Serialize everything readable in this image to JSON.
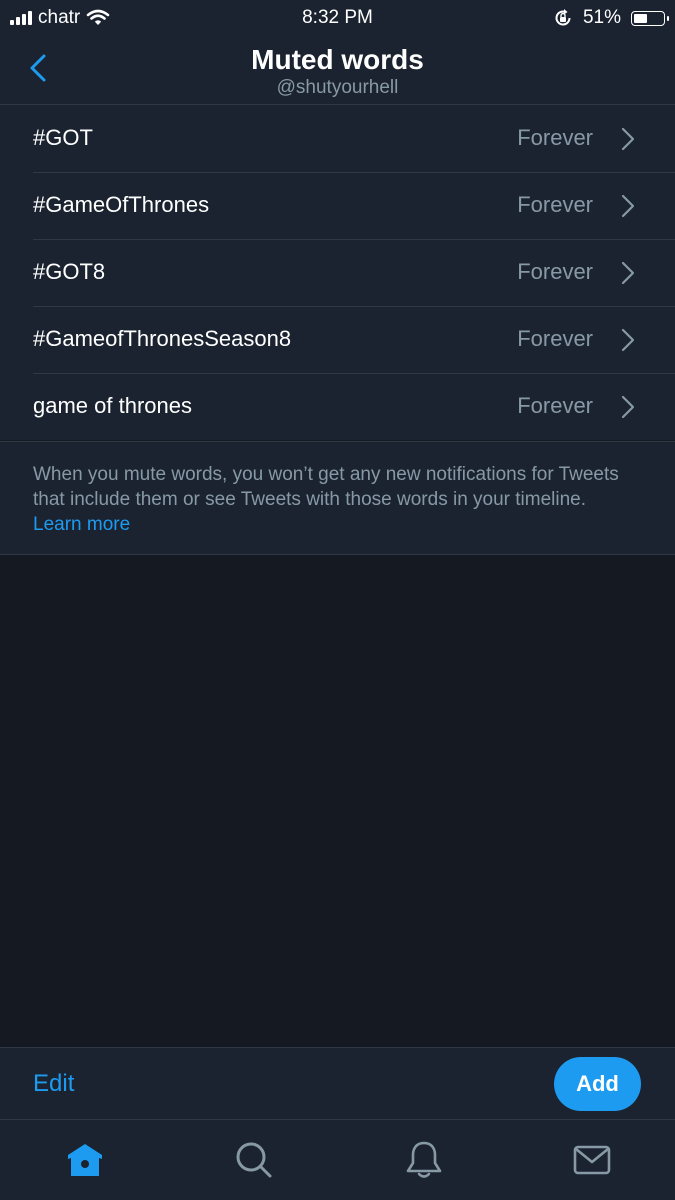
{
  "status_bar": {
    "carrier": "chatr",
    "time": "8:32 PM",
    "battery_percent": "51%",
    "battery_level": 0.51,
    "icons": [
      "signal-bars-icon",
      "wifi-icon",
      "orientation-lock-icon",
      "battery-icon"
    ]
  },
  "header": {
    "title": "Muted words",
    "subtitle": "@shutyourhell",
    "back_icon": "chevron-left-icon"
  },
  "muted_words": [
    {
      "word": "#GOT",
      "duration": "Forever"
    },
    {
      "word": "#GameOfThrones",
      "duration": "Forever"
    },
    {
      "word": "#GOT8",
      "duration": "Forever"
    },
    {
      "word": "#GameofThronesSeason8",
      "duration": "Forever"
    },
    {
      "word": "game of thrones",
      "duration": "Forever"
    }
  ],
  "info": {
    "text": "When you mute words, you won’t get any new notifications for Tweets that include them or see Tweets with those words in your timeline.",
    "link": "Learn more"
  },
  "actions": {
    "edit_label": "Edit",
    "add_label": "Add"
  },
  "tab_bar": {
    "tabs": [
      "home-icon",
      "search-icon",
      "notifications-bell-icon",
      "messages-envelope-icon"
    ],
    "active": "home-icon"
  },
  "colors": {
    "accent": "#1d9bf0",
    "background": "#141922",
    "surface": "#1b2330",
    "secondary_text": "#8899a6",
    "divider": "#2f3946"
  }
}
